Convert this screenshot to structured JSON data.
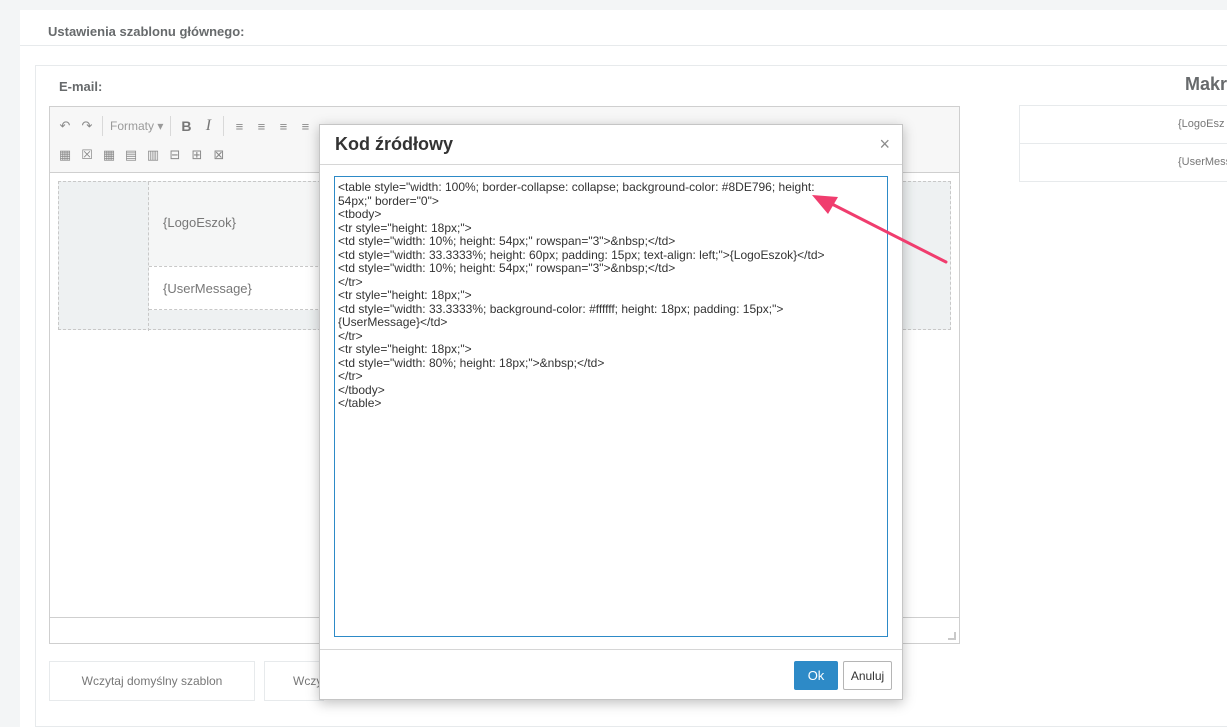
{
  "page": {
    "section_title": "Ustawienia szablonu głównego:",
    "email_label": "E-mail:"
  },
  "toolbar": {
    "row1": [
      {
        "icon": "undo-icon",
        "glyph": "↶"
      },
      {
        "icon": "redo-icon",
        "glyph": "↷"
      },
      {
        "label": "Formaty ▾"
      },
      {
        "icon": "bold-icon",
        "glyph": "B"
      },
      {
        "icon": "italic-icon",
        "glyph": "I"
      },
      {
        "icon": "align-left-icon",
        "glyph": "≡"
      },
      {
        "icon": "align-center-icon",
        "glyph": "≡"
      },
      {
        "icon": "align-right-icon",
        "glyph": "≡"
      },
      {
        "icon": "align-justify-icon",
        "glyph": "≡"
      }
    ],
    "row2": [
      {
        "icon": "table-icon",
        "glyph": "▦"
      },
      {
        "icon": "table-delete-icon",
        "glyph": "☒"
      },
      {
        "icon": "table-props-icon",
        "glyph": "▦"
      },
      {
        "icon": "table-row-icon",
        "glyph": "▤"
      },
      {
        "icon": "table-cell-icon",
        "glyph": "▥"
      },
      {
        "icon": "insert-row-before-icon",
        "glyph": "⊟"
      },
      {
        "icon": "insert-row-after-icon",
        "glyph": "⊞"
      },
      {
        "icon": "delete-row-icon",
        "glyph": "⊠"
      }
    ]
  },
  "editor": {
    "macro_logo": "{LogoEszok}",
    "macro_user": "{UserMessage}"
  },
  "buttons": {
    "load_default": "Wczytaj domyślny szablon",
    "load_other": "Wczy"
  },
  "macros": {
    "title": "Makr",
    "items": [
      "{LogoEsz",
      "{UserMess"
    ]
  },
  "modal": {
    "title": "Kod źródłowy",
    "close": "×",
    "source_lines": [
      "<table style=\"width: 100%; border-collapse: collapse; background-color: #8DE796; height:",
      "54px;\" border=\"0\">",
      "<tbody>",
      "<tr style=\"height: 18px;\">",
      "<td style=\"width: 10%; height: 54px;\" rowspan=\"3\">&nbsp;</td>",
      "<td style=\"width: 33.3333%; height: 60px; padding: 15px; text-align: left;\">{LogoEszok}</td>",
      "<td style=\"width: 10%; height: 54px;\" rowspan=\"3\">&nbsp;</td>",
      "</tr>",
      "<tr style=\"height: 18px;\">",
      "<td style=\"width: 33.3333%; background-color: #ffffff; height: 18px; padding: 15px;\">",
      "{UserMessage}</td>",
      "</tr>",
      "<tr style=\"height: 18px;\">",
      "<td style=\"width: 80%; height: 18px;\">&nbsp;</td>",
      "</tr>",
      "</tbody>",
      "</table>"
    ],
    "ok": "Ok",
    "cancel": "Anuluj"
  },
  "colors": {
    "accent": "#2d8ac7",
    "arrow": "#f03d6e",
    "template_bg": "#eef1f2"
  }
}
